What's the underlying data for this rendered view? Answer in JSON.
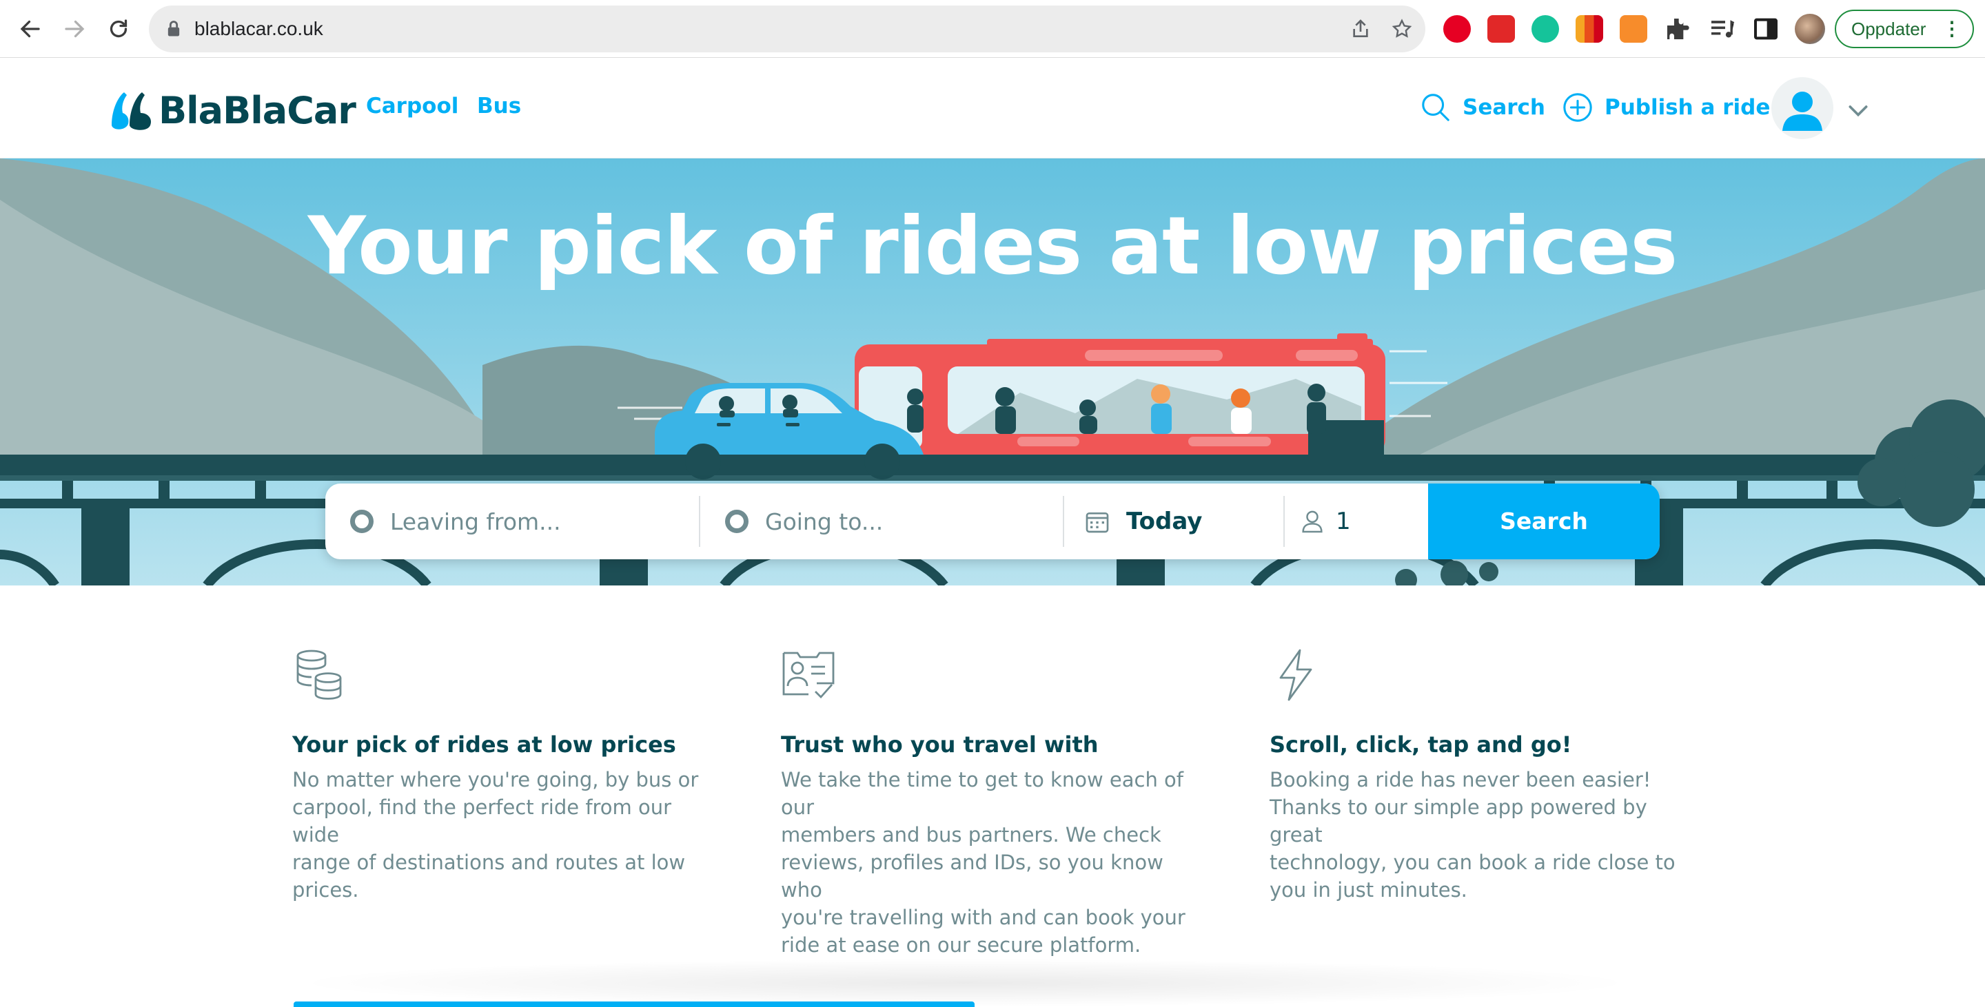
{
  "browser": {
    "url": "blablacar.co.uk",
    "update_button": "Oppdater"
  },
  "header": {
    "logo_text": "BlaBlaCar",
    "nav": [
      "Carpool",
      "Bus"
    ],
    "search_label": "Search",
    "publish_label": "Publish a ride"
  },
  "hero": {
    "title": "Your pick of rides at low prices"
  },
  "search_form": {
    "leaving_placeholder": "Leaving from...",
    "going_placeholder": "Going to...",
    "date_value": "Today",
    "passengers_value": "1",
    "search_button": "Search"
  },
  "features": [
    {
      "icon": "coins-icon",
      "title": "Your pick of rides at low prices",
      "text_lines": [
        "No matter where you're going, by bus or",
        "carpool, find the perfect ride from our wide",
        "range of destinations and routes at low",
        "prices."
      ]
    },
    {
      "icon": "id-card-check-icon",
      "title": "Trust who you travel with",
      "text_lines": [
        "We take the time to get to know each of our",
        "members and bus partners. We check",
        "reviews, profiles and IDs, so you know who",
        "you're travelling with and can book your",
        "ride at ease on our secure platform."
      ]
    },
    {
      "icon": "lightning-icon",
      "title": "Scroll, click, tap and go!",
      "text_lines": [
        "Booking a ride has never been easier!",
        "Thanks to our simple app powered by great",
        "technology, you can book a ride close to",
        "you in just minutes."
      ]
    }
  ],
  "colors": {
    "brand_blue": "#00aff5",
    "brand_dark": "#054752",
    "muted": "#708c91",
    "bus_red": "#f05656",
    "car_blue": "#3ab4e6"
  }
}
